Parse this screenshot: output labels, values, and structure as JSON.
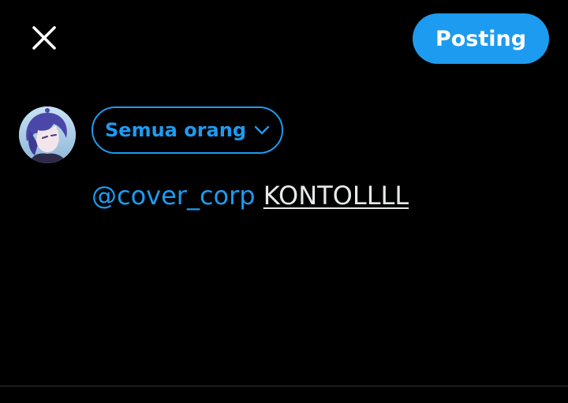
{
  "header": {
    "close_icon": "close-icon",
    "post_label": "Posting"
  },
  "composer": {
    "avatar_icon": "user-avatar",
    "audience_label": "Semua orang",
    "audience_icon": "chevron-down-icon",
    "mention": "@cover_corp",
    "typed_text": "KONTOLLLL"
  },
  "colors": {
    "accent": "#1D9BF0",
    "background": "#000000",
    "text": "#e7e9ea",
    "divider": "#2f3336"
  }
}
